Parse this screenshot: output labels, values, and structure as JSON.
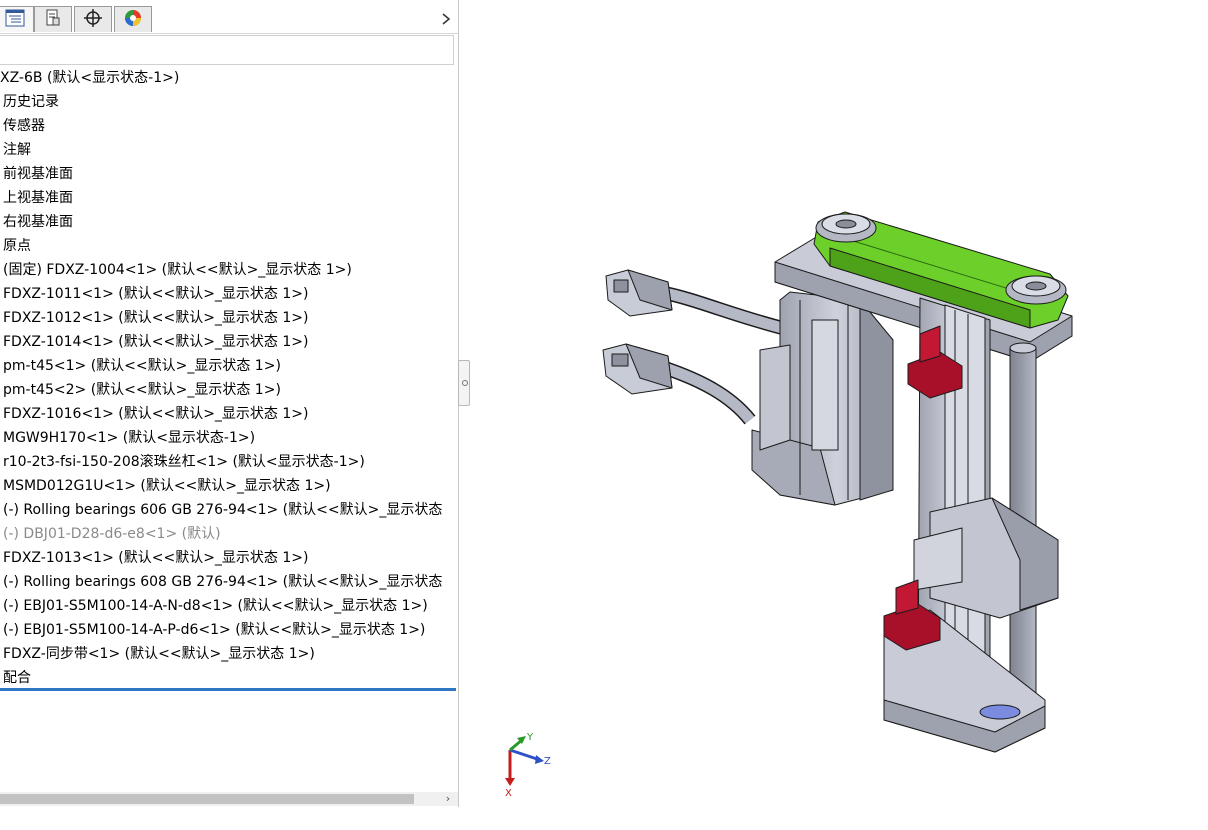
{
  "feature_tree": {
    "items": [
      {
        "label": "XZ-6B  (默认<显示状态-1>)",
        "dim": false
      },
      {
        "label": "历史记录",
        "dim": false
      },
      {
        "label": "传感器",
        "dim": false
      },
      {
        "label": "注解",
        "dim": false
      },
      {
        "label": "前视基准面",
        "dim": false
      },
      {
        "label": "上视基准面",
        "dim": false
      },
      {
        "label": "右视基准面",
        "dim": false
      },
      {
        "label": "原点",
        "dim": false
      },
      {
        "label": "(固定) FDXZ-1004<1> (默认<<默认>_显示状态 1>)",
        "dim": false
      },
      {
        "label": "FDXZ-1011<1> (默认<<默认>_显示状态 1>)",
        "dim": false
      },
      {
        "label": "FDXZ-1012<1> (默认<<默认>_显示状态 1>)",
        "dim": false
      },
      {
        "label": "FDXZ-1014<1> (默认<<默认>_显示状态 1>)",
        "dim": false
      },
      {
        "label": "pm-t45<1> (默认<<默认>_显示状态 1>)",
        "dim": false
      },
      {
        "label": "pm-t45<2> (默认<<默认>_显示状态 1>)",
        "dim": false
      },
      {
        "label": "FDXZ-1016<1> (默认<<默认>_显示状态 1>)",
        "dim": false
      },
      {
        "label": "MGW9H170<1> (默认<显示状态-1>)",
        "dim": false
      },
      {
        "label": "r10-2t3-fsi-150-208滚珠丝杠<1> (默认<显示状态-1>)",
        "dim": false
      },
      {
        "label": "MSMD012G1U<1> (默认<<默认>_显示状态 1>)",
        "dim": false
      },
      {
        "label": "(-) Rolling bearings 606 GB 276-94<1> (默认<<默认>_显示状态",
        "dim": false
      },
      {
        "label": "(-) DBJ01-D28-d6-e8<1> (默认)",
        "dim": true
      },
      {
        "label": "FDXZ-1013<1> (默认<<默认>_显示状态 1>)",
        "dim": false
      },
      {
        "label": "(-) Rolling bearings 608 GB 276-94<1> (默认<<默认>_显示状态",
        "dim": false
      },
      {
        "label": "(-) EBJ01-S5M100-14-A-N-d8<1> (默认<<默认>_显示状态 1>)",
        "dim": false
      },
      {
        "label": "(-) EBJ01-S5M100-14-A-P-d6<1> (默认<<默认>_显示状态 1>)",
        "dim": false
      },
      {
        "label": "FDXZ-同步带<1> (默认<<默认>_显示状态 1>)",
        "dim": false
      },
      {
        "label": "配合",
        "dim": false
      }
    ]
  },
  "tabs": [
    {
      "icon": "feature-tree-icon"
    },
    {
      "icon": "property-manager-icon"
    },
    {
      "icon": "configuration-crosshair-icon"
    },
    {
      "icon": "display-manager-pie-icon"
    }
  ],
  "triad": {
    "x_label": "X",
    "y_label": "Y",
    "z_label": "Z"
  },
  "colors": {
    "belt": "#6ccf2a",
    "sensor_bracket": "#a8102a",
    "steel": "#b8bcc8",
    "selection_bar": "#2f77c2"
  }
}
